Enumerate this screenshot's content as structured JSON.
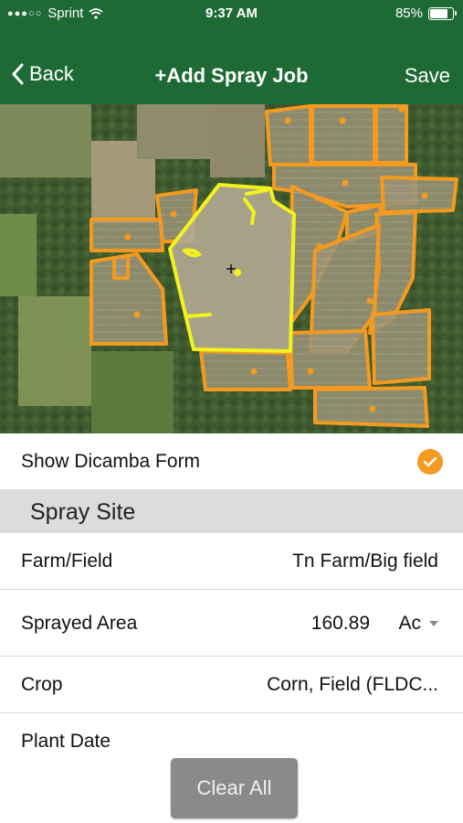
{
  "status_bar": {
    "carrier": "Sprint",
    "signal_dots": "●●●○○",
    "time": "9:37 AM",
    "battery_percent": "85%",
    "battery_level": 0.85
  },
  "nav": {
    "back_label": "Back",
    "title": "+Add Spray Job",
    "save_label": "Save"
  },
  "form": {
    "show_dicamba": {
      "label": "Show Dicamba Form",
      "checked": true
    },
    "section_title": "Spray Site",
    "farm_field": {
      "label": "Farm/Field",
      "value": "Tn Farm/Big field"
    },
    "sprayed_area": {
      "label": "Sprayed Area",
      "value": "160.89",
      "unit": "Ac"
    },
    "crop": {
      "label": "Crop",
      "value": "Corn, Field (FLDC..."
    },
    "plant_date": {
      "label": "Plant Date",
      "value": ""
    }
  },
  "clear_all_label": "Clear All",
  "colors": {
    "header_green": "#1d6a34",
    "field_outline": "#f39a1f",
    "selected_field_outline": "#f2f21c",
    "check_orange": "#f39a1f"
  }
}
